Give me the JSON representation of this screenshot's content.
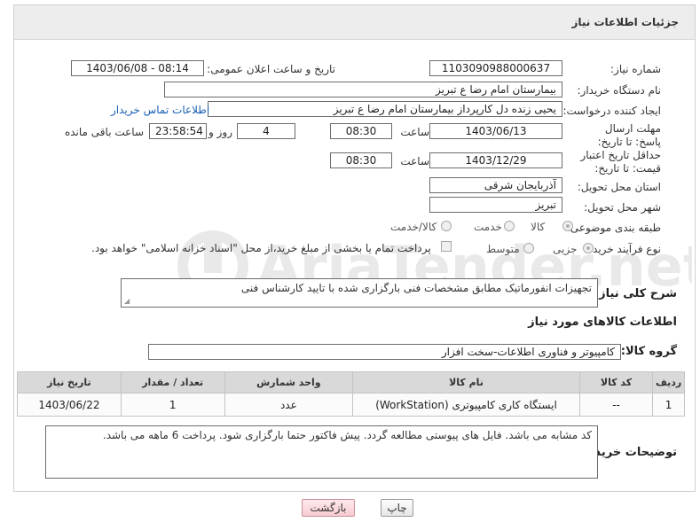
{
  "header": {
    "title": "جزئیات اطلاعات نیاز"
  },
  "fields": {
    "need_number_label": "شماره نیاز:",
    "need_number": "1103090988000637",
    "announce_label": "تاریخ و ساعت اعلان عمومی:",
    "announce_value": "1403/06/08 - 08:14",
    "buyer_org_label": "نام دستگاه خریدار:",
    "buyer_org": "بیمارستان امام رضا  ع  تبریز",
    "requester_label": "ایجاد کننده درخواست:",
    "requester": "یحیی زنده دل کارپرداز بیمارستان امام رضا  ع  تبریز",
    "contact_link": "اطلاعات تماس خریدار",
    "reply_deadline_label": "مهلت ارسال پاسخ: تا تاریخ:",
    "reply_date": "1403/06/13",
    "time_label": "ساعت",
    "reply_time": "08:30",
    "days_value": "4",
    "days_label": "روز و",
    "remaining_value": "23:58:54",
    "remaining_label": "ساعت باقی مانده",
    "price_validity_label": "حداقل تاریخ اعتبار قیمت: تا تاریخ:",
    "validity_date": "1403/12/29",
    "validity_time": "08:30",
    "province_label": "استان محل تحویل:",
    "province": "آذربایجان شرقی",
    "city_label": "شهر محل تحویل:",
    "city": "تبریز",
    "category_label": "طبقه بندی موضوعی:",
    "category_options": [
      "کالا",
      "خدمت",
      "کالا/خدمت"
    ],
    "purchase_type_label": "نوع فرآیند خرید :",
    "purchase_options": [
      "جزیی",
      "متوسط"
    ],
    "payment_note": "پرداخت تمام یا بخشی از مبلغ خرید،از محل \"اسناد خزانه اسلامی\" خواهد بود.",
    "description_label": "شرح کلی نیاز:",
    "description": "تجهیزات انفورماتیک مطابق مشخصات فنی بارگزاری شده با تایید کارشناس فنی",
    "goods_info_title": "اطلاعات کالاهای مورد نیاز",
    "goods_group_label": "گروه کالا:",
    "goods_group": "کامپیوتر و فناوری اطلاعات-سخت افزار",
    "buyer_notes_label": "توضیحات خریدار:",
    "buyer_notes": "کد مشابه می باشد. فایل های پیوستی مطالعه گردد. پیش فاکتور حتما بارگزاری شود. پرداخت 6 ماهه می باشد."
  },
  "table": {
    "headers": [
      "ردیف",
      "کد کالا",
      "نام کالا",
      "واحد شمارش",
      "تعداد / مقدار",
      "تاریخ نیاز"
    ],
    "rows": [
      [
        "1",
        "--",
        "ایستگاه کاری کامپیوتری (WorkStation)",
        "عدد",
        "1",
        "1403/06/22"
      ]
    ]
  },
  "buttons": {
    "print": "چاپ",
    "back": "بازگشت"
  },
  "watermark": {
    "text": "AriaTender.net"
  },
  "colors": {
    "link": "#1a5fb4",
    "header_bg": "#ededed",
    "table_head_bg": "#d9d9d9"
  }
}
